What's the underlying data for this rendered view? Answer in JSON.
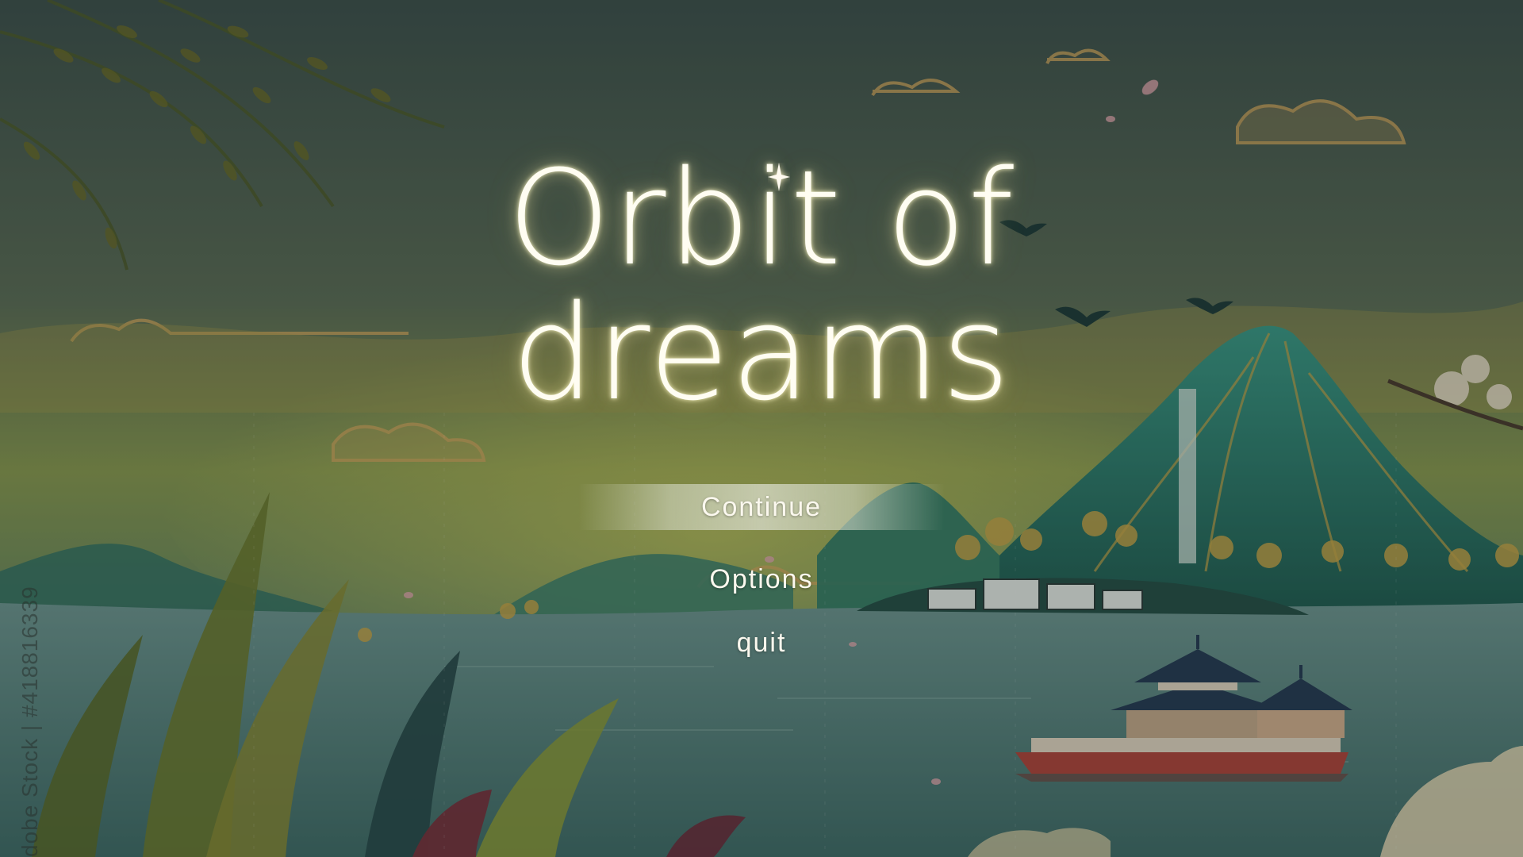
{
  "game": {
    "title_line1": "Orbit of",
    "title_line2": "dreams"
  },
  "menu": {
    "continue_label": "Continue",
    "options_label": "Options",
    "quit_label": "quit",
    "selected": "Continue"
  },
  "watermark": "dobe Stock | #418816339",
  "colors": {
    "sky": "#5a6e58",
    "lake": "#4f7c72",
    "mountain": "#2f8f7a",
    "cloud_gold": "#d8b06a",
    "title_glow": "#fff4c0",
    "boat_red": "#b2433a",
    "roof_navy": "#243a52"
  }
}
